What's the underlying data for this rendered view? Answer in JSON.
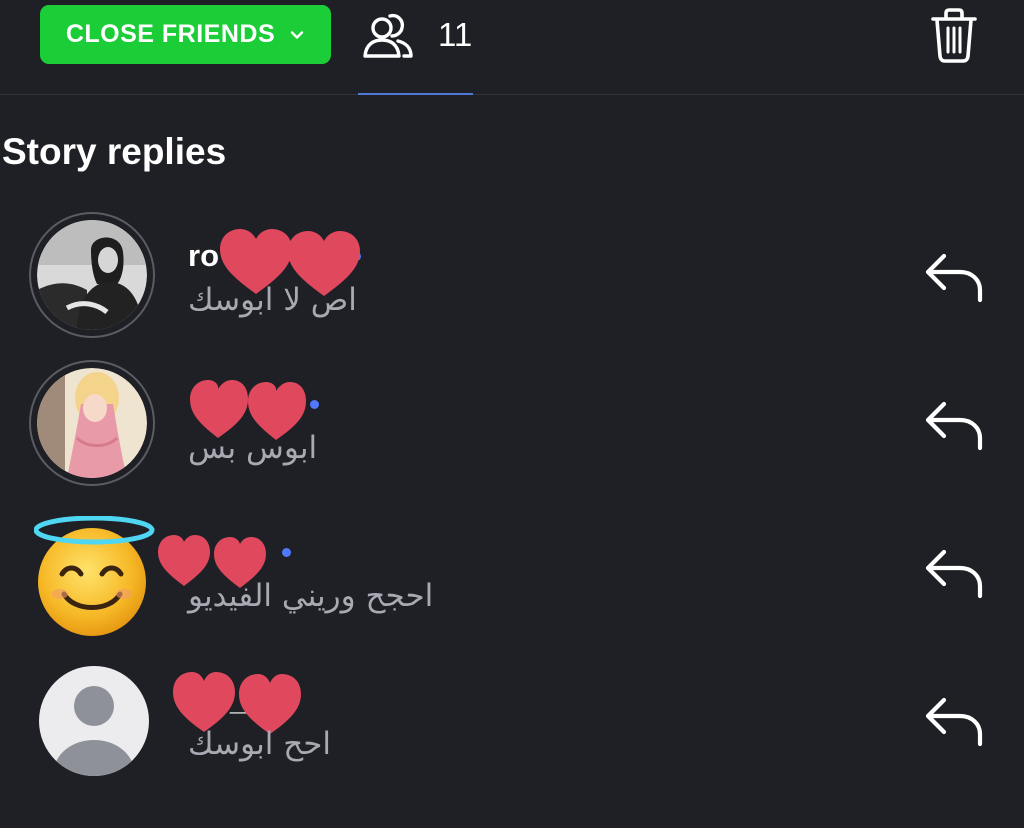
{
  "topbar": {
    "audience_button": {
      "label": "CLOSE FRIENDS",
      "color": "#1bce38",
      "icon": "chevron-down-icon"
    },
    "viewers": {
      "icon": "viewers-icon",
      "count": "11"
    },
    "delete_icon": "trash-icon"
  },
  "section": {
    "title": "Story replies"
  },
  "replies": [
    {
      "username": "ro",
      "username_tail": "e",
      "message": "اص لا ابوسك",
      "unread": true,
      "avatar": "photo-grayscale-woman"
    },
    {
      "username": "",
      "username_tail": "",
      "message": "ابوس بس",
      "unread": true,
      "avatar": "photo-anime-pink"
    },
    {
      "username": "",
      "username_tail": "",
      "message": "احجح وريني الفيديو",
      "unread": true,
      "avatar": "smiling-face-with-halo-emoji"
    },
    {
      "username": "",
      "username_tail": "_",
      "message": "احح ابوسك",
      "unread": false,
      "avatar": "default-avatar-silhouette"
    }
  ],
  "colors": {
    "background": "#1f2026",
    "accent_green": "#1bce38",
    "unread_dot": "#4f78ff",
    "secondary_text": "#a8a9b2",
    "heart_red": "#e0485e"
  },
  "reply_icon": "reply-arrow-icon"
}
